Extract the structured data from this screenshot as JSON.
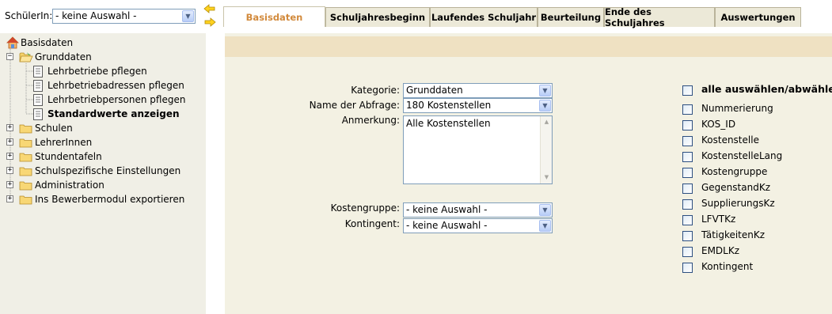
{
  "header": {
    "student_label": "SchülerIn:",
    "student_select_value": "- keine Auswahl -"
  },
  "tabs": [
    {
      "label": "Basisdaten",
      "active": true
    },
    {
      "label": "Schuljahresbeginn",
      "active": false
    },
    {
      "label": "Laufendes Schuljahr",
      "active": false
    },
    {
      "label": "Beurteilung",
      "active": false
    },
    {
      "label": "Ende des Schuljahres",
      "active": false
    },
    {
      "label": "Auswertungen",
      "active": false
    }
  ],
  "tree": {
    "root": "Basisdaten",
    "grunddaten": "Grunddaten",
    "children": [
      "Lehrbetriebe pflegen",
      "Lehrbetriebadressen pflegen",
      "Lehrbetriebpersonen pflegen",
      "Standardwerte anzeigen"
    ],
    "folders": [
      "Schulen",
      "LehrerInnen",
      "Stundentafeln",
      "Schulspezifische Einstellungen",
      "Administration",
      "Ins Bewerbermodul exportieren"
    ]
  },
  "form": {
    "kategorie_label": "Kategorie:",
    "kategorie_value": "Grunddaten",
    "abfrage_label": "Name der Abfrage:",
    "abfrage_value": "180 Kostenstellen",
    "anmerkung_label": "Anmerkung:",
    "anmerkung_value": "Alle Kostenstellen",
    "kostengruppe_label": "Kostengruppe:",
    "kostengruppe_value": "- keine Auswahl -",
    "kontingent_label": "Kontingent:",
    "kontingent_value": "- keine Auswahl -"
  },
  "columns": {
    "select_all": "alle auswählen/abwählen",
    "items": [
      "Nummerierung",
      "KOS_ID",
      "Kostenstelle",
      "KostenstelleLang",
      "Kostengruppe",
      "GegenstandKz",
      "SupplierungsKz",
      "LFVTKz",
      "TätigkeitenKz",
      "EMDLKz",
      "Kontingent"
    ]
  },
  "colors": {
    "tab_active_text": "#d28a3c",
    "panel_band": "#efe1c2",
    "panel_bg": "#f3f1e3",
    "tree_bg": "#f0efe6"
  }
}
